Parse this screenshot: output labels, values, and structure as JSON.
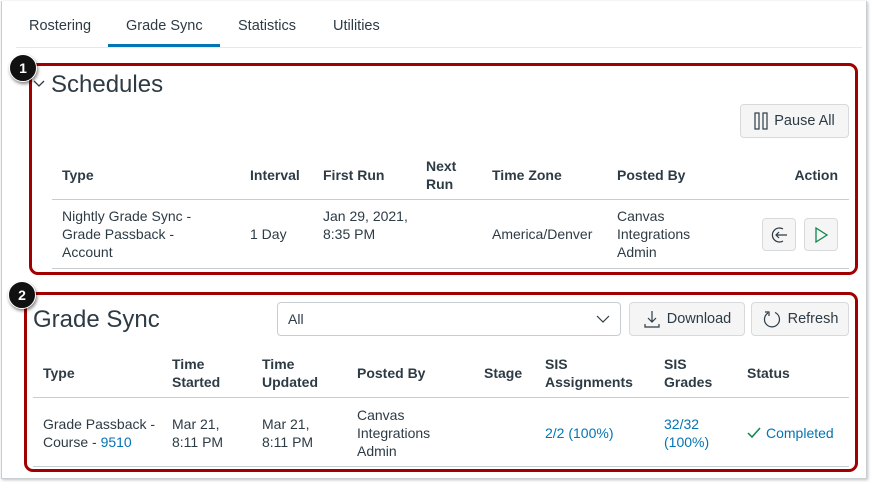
{
  "tabs": [
    {
      "label": "Rostering"
    },
    {
      "label": "Grade Sync"
    },
    {
      "label": "Statistics"
    },
    {
      "label": "Utilities"
    }
  ],
  "badges": [
    "1",
    "2"
  ],
  "schedules": {
    "title": "Schedules",
    "pause_all": "Pause All",
    "headers": [
      "Type",
      "Interval",
      "First Run",
      "Next Run",
      "Time Zone",
      "Posted By",
      "Action"
    ],
    "row": {
      "type": "Nightly Grade Sync - Grade Passback - Account",
      "interval": "1 Day",
      "first_run": "Jan 29, 2021, 8:35 PM",
      "next_run": "",
      "time_zone": "America/Denver",
      "posted_by": "Canvas Integrations Admin"
    }
  },
  "grade_sync": {
    "title": "Grade Sync",
    "filter_value": "All",
    "download": "Download",
    "refresh": "Refresh",
    "headers": [
      "Type",
      "Time Started",
      "Time Updated",
      "Posted By",
      "Stage",
      "SIS Assignments",
      "SIS Grades",
      "Status"
    ],
    "row": {
      "type_prefix": "Grade Passback - Course - ",
      "type_link": "9510",
      "time_started": "Mar 21, 8:11 PM",
      "time_updated": "Mar 21, 8:11 PM",
      "posted_by": "Canvas Integrations Admin",
      "stage": "",
      "sis_assignments": "2/2 (100%)",
      "sis_grades": "32/32 (100%)",
      "status": "Completed"
    }
  },
  "colors": {
    "accent": "#0374b5",
    "highlight": "#a00000",
    "success": "#0b874b"
  }
}
